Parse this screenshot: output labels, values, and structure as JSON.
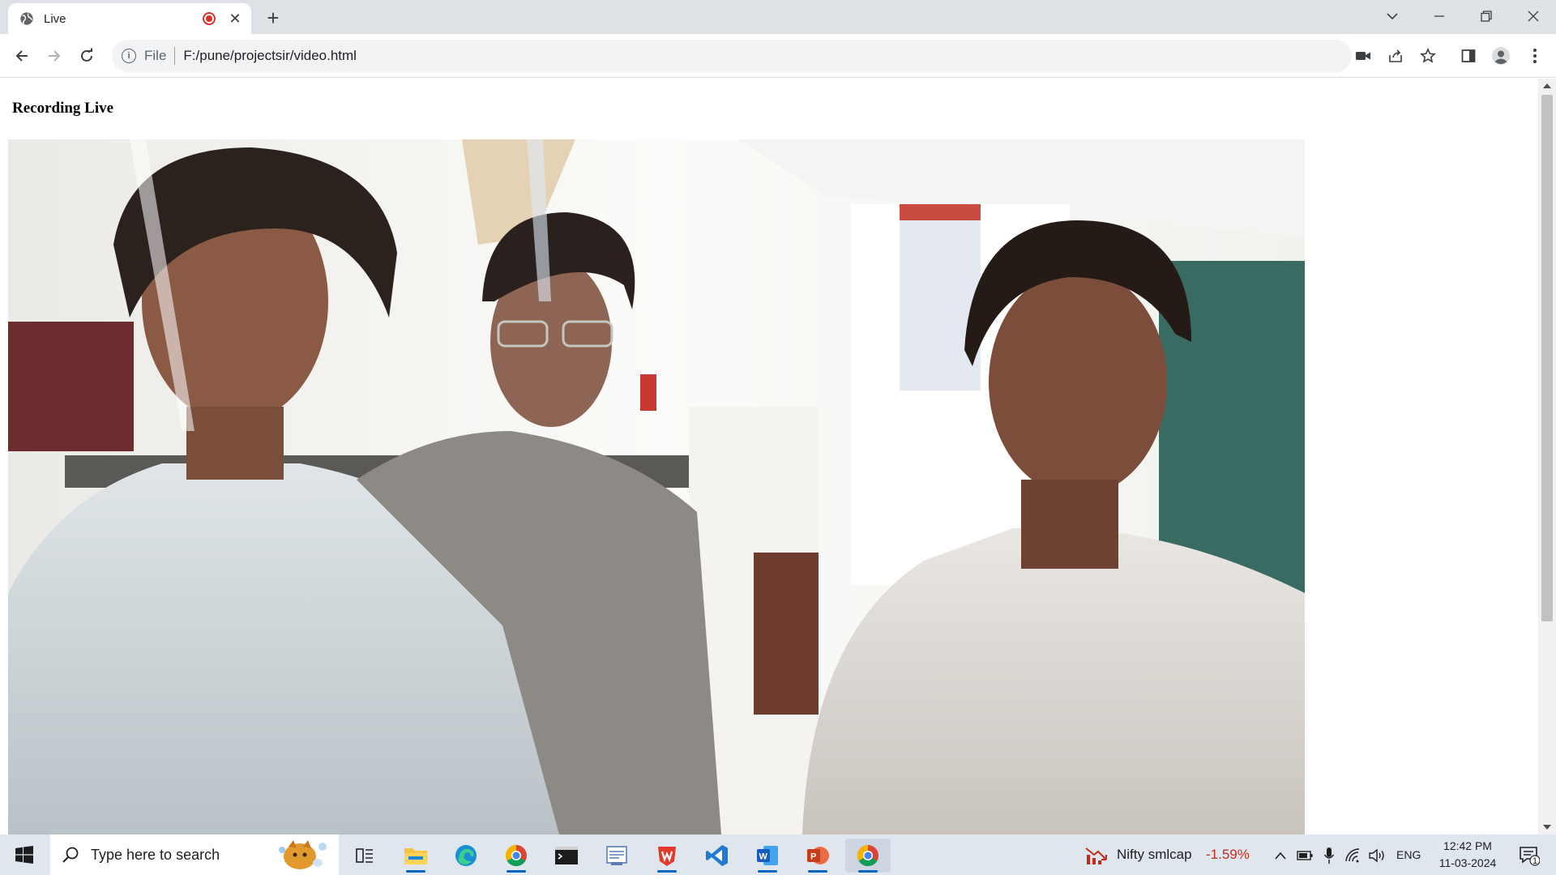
{
  "browser": {
    "tab_title": "Live",
    "close_glyph": "✕",
    "new_tab_glyph": "+",
    "omnibox": {
      "scheme_label": "File",
      "url": "F:/pune/projectsir/video.html"
    },
    "window_controls": {
      "tabsearch": "⌵",
      "minimize": "—",
      "restore": "❐",
      "close": "✕"
    }
  },
  "page": {
    "heading": "Recording Live"
  },
  "taskbar": {
    "search_placeholder": "Type here to search",
    "widget_label": "Nifty smlcap",
    "widget_change": "-1.59%",
    "language": "ENG",
    "time": "12:42 PM",
    "date": "11-03-2024",
    "notification_count": "1"
  },
  "colors": {
    "accent": "#0067c0",
    "recording": "#d93025",
    "negative": "#c42b1c"
  }
}
